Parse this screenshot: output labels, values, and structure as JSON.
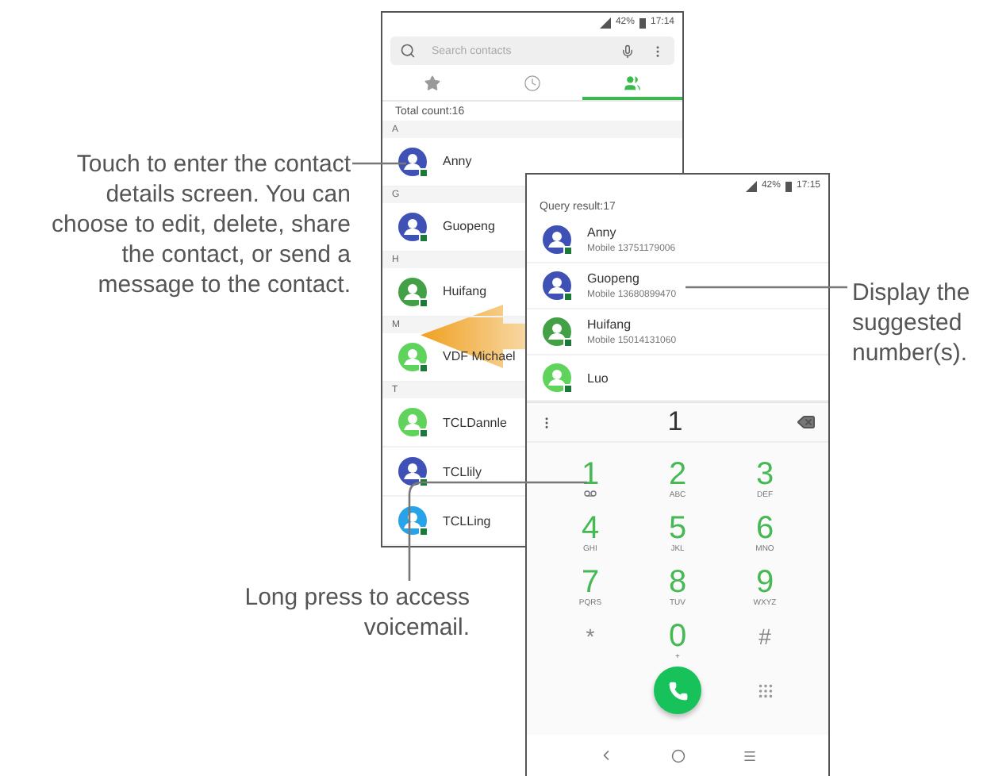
{
  "contacts_screen": {
    "status_bar": {
      "battery": "42%",
      "time": "17:14"
    },
    "search": {
      "placeholder": "Search contacts"
    },
    "tabs": [
      {
        "kind": "favorites",
        "selected": false
      },
      {
        "kind": "recent",
        "selected": false
      },
      {
        "kind": "contacts",
        "selected": true
      }
    ],
    "total_count": "Total count:16",
    "sections": [
      {
        "letter": "A",
        "contacts": [
          {
            "name": "Anny",
            "color": "#3f51b5"
          }
        ]
      },
      {
        "letter": "G",
        "contacts": [
          {
            "name": "Guopeng",
            "color": "#3f51b5"
          }
        ]
      },
      {
        "letter": "H",
        "contacts": [
          {
            "name": "Huifang",
            "color": "#43a047"
          }
        ]
      },
      {
        "letter": "M",
        "contacts": [
          {
            "name": "VDF Michael",
            "color": "#5fd35b"
          }
        ]
      },
      {
        "letter": "T",
        "contacts": [
          {
            "name": "TCLDannle",
            "color": "#5fd35b"
          },
          {
            "name": "TCLlily",
            "color": "#3f51b5"
          },
          {
            "name": "TCLLing",
            "color": "#29a3e8"
          }
        ]
      }
    ]
  },
  "dialer_screen": {
    "status_bar": {
      "battery": "42%",
      "time": "17:15"
    },
    "query_result": "Query result:17",
    "results": [
      {
        "name": "Anny",
        "number": "Mobile 13751179006",
        "color": "#3f51b5"
      },
      {
        "name": "Guopeng",
        "number": "Mobile 13680899470",
        "color": "#3f51b5"
      },
      {
        "name": "Huifang",
        "number": "Mobile 15014131060",
        "color": "#43a047"
      },
      {
        "name": "Luo",
        "color": "#5fd35b"
      }
    ],
    "dialed": "1",
    "keys": [
      {
        "kind": "voicemail",
        "digit": "1"
      },
      {
        "kind": "digit",
        "digit": "2",
        "letters": "ABC"
      },
      {
        "kind": "digit",
        "digit": "3",
        "letters": "DEF"
      },
      {
        "kind": "digit",
        "digit": "4",
        "letters": "GHI"
      },
      {
        "kind": "digit",
        "digit": "5",
        "letters": "JKL"
      },
      {
        "kind": "digit",
        "digit": "6",
        "letters": "MNO"
      },
      {
        "kind": "digit",
        "digit": "7",
        "letters": "PQRS"
      },
      {
        "kind": "digit",
        "digit": "8",
        "letters": "TUV"
      },
      {
        "kind": "digit",
        "digit": "9",
        "letters": "WXYZ"
      },
      {
        "kind": "symbol",
        "digit": "*"
      },
      {
        "kind": "digit",
        "digit": "0",
        "letters": "+"
      },
      {
        "kind": "symbol",
        "digit": "#"
      }
    ]
  },
  "callouts": [
    {
      "text": "Touch to enter the contact details screen. You can choose to edit, delete, share the contact, or send a message to the contact."
    },
    {
      "text": "Long press to access voicemail."
    },
    {
      "text": "Display the suggested number(s)."
    }
  ]
}
